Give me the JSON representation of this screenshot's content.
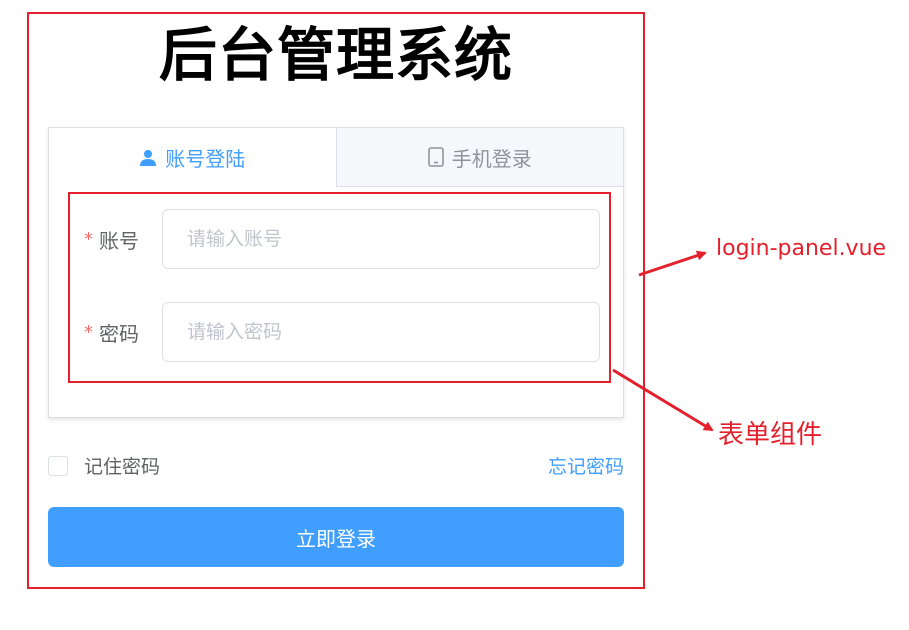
{
  "title": "后台管理系统",
  "tabs": [
    {
      "label": "账号登陆",
      "icon": "user-icon",
      "active": true
    },
    {
      "label": "手机登录",
      "icon": "mobile-phone-icon",
      "active": false
    }
  ],
  "form": {
    "account": {
      "label": "账号",
      "placeholder": "请输入账号",
      "required": true
    },
    "password": {
      "label": "密码",
      "placeholder": "请输入密码",
      "required": true
    }
  },
  "remember": {
    "label": "记住密码",
    "checked": false
  },
  "forgot": {
    "label": "忘记密码"
  },
  "submit": {
    "label": "立即登录"
  },
  "annotations": {
    "panel": "login-panel.vue",
    "form": "表单组件"
  },
  "colors": {
    "accent": "#409eff",
    "annotation": "#e3202c",
    "required_star": "#f56c6c",
    "tab_inactive_bg": "#f5f7fa"
  }
}
